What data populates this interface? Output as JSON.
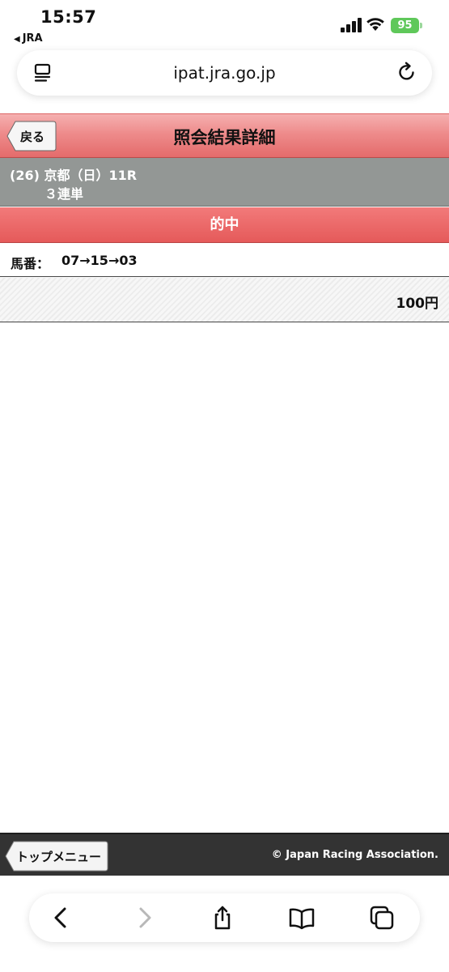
{
  "status_bar": {
    "time": "15:57",
    "back_app_label": "JRA",
    "battery_level": "95"
  },
  "url_bar": {
    "url": "ipat.jra.go.jp"
  },
  "header": {
    "back_label": "戻る",
    "title": "照会結果詳細"
  },
  "race": {
    "line1": "(26) 京都（日）11R",
    "bet_type": "３連単"
  },
  "result": {
    "label": "的中"
  },
  "horse": {
    "label": "馬番：",
    "value": "07→15→03"
  },
  "amount": {
    "value": "100円"
  },
  "footer": {
    "top_menu_label": "トップメニュー",
    "copyright": "© Japan Racing Association."
  },
  "colors": {
    "header_red": "#e46b6b",
    "result_red": "#e55a5a",
    "race_gray": "#939795",
    "footer_dark": "#333333",
    "battery_green": "#5fc85a"
  }
}
